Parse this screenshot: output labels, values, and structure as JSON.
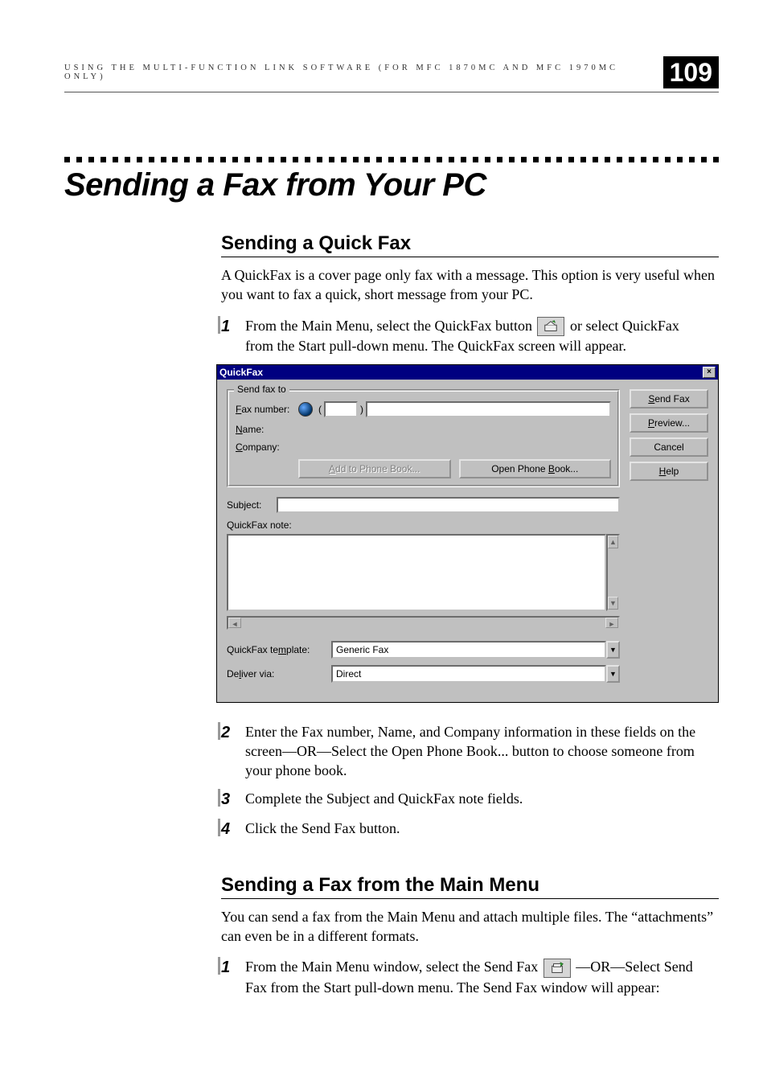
{
  "header": {
    "running_head": "USING THE MULTI-FUNCTION LINK SOFTWARE (FOR MFC 1870MC AND MFC 1970MC ONLY)",
    "page_number": "109"
  },
  "section": {
    "title": "Sending a Fax from Your PC"
  },
  "quickfax": {
    "heading": "Sending a Quick Fax",
    "intro": "A QuickFax is a cover page only fax with a message.  This option is very useful when you want to fax a quick, short message from your PC.",
    "step1_a": "From the Main Menu, select the QuickFax button ",
    "step1_b": " or select QuickFax from the Start pull-down menu.  The QuickFax screen will appear.",
    "step2": "Enter the Fax number, Name, and Company information in these fields on the screen—OR—Select the Open Phone Book... button to choose someone from your phone book.",
    "step3": "Complete the Subject and QuickFax note fields.",
    "step4": "Click the Send Fax button."
  },
  "dialog": {
    "title": "QuickFax",
    "close_glyph": "×",
    "groupbox_label": "Send fax to",
    "fax_number_label": "Fax number:",
    "fax_u": "F",
    "name_label": "ame:",
    "name_u": "N",
    "company_label": "ompany:",
    "company_u": "C",
    "paren_open": "(",
    "paren_close": ")",
    "add_btn_pre": "",
    "add_btn_u": "A",
    "add_btn_post": "dd to Phone Book...",
    "open_btn_pre": "Open Phone ",
    "open_btn_u": "B",
    "open_btn_post": "ook...",
    "send_u": "S",
    "send_post": "end Fax",
    "preview_u": "P",
    "preview_post": "review...",
    "cancel": "Cancel",
    "help_u": "H",
    "help_post": "elp",
    "subject_label": "Subject:",
    "note_label": "QuickFax note:",
    "template_label_pre": "QuickFax te",
    "template_label_u": "m",
    "template_label_post": "plate:",
    "template_value": "Generic Fax",
    "deliver_label_pre": "De",
    "deliver_label_u": "l",
    "deliver_label_post": "iver via:",
    "deliver_value": "Direct",
    "up_glyph": "▲",
    "down_glyph": "▼",
    "left_glyph": "◄",
    "right_glyph": "►"
  },
  "mainmenu": {
    "heading": "Sending a Fax from the Main Menu",
    "intro": "You can send a fax from the Main Menu and attach multiple files. The “attachments” can even be in a different formats.",
    "step1_a": "From the Main Menu window, select the Send Fax ",
    "step1_b": " —OR—Select Send Fax  from the Start pull-down menu.  The Send Fax window will appear:"
  },
  "nums": {
    "n1": "1",
    "n2": "2",
    "n3": "3",
    "n4": "4"
  }
}
